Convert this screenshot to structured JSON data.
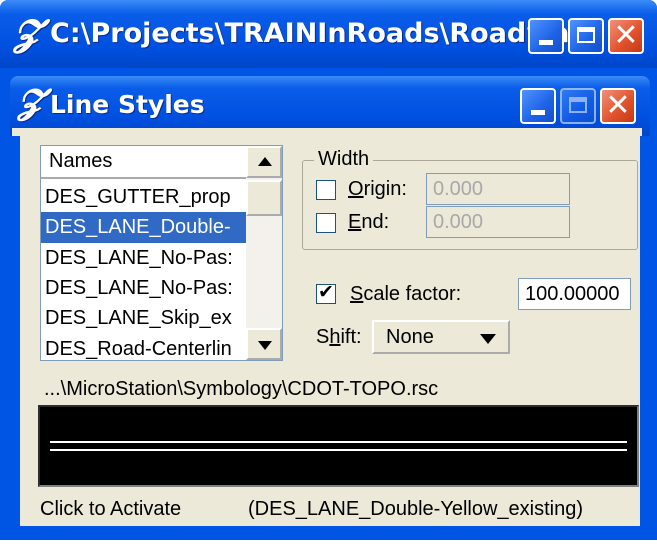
{
  "outer_window": {
    "title": "C:\\Projects\\TRAINInRoads\\Roadwa...",
    "icon": "microstation-icon"
  },
  "dialog": {
    "title": "Line Styles",
    "icon": "microstation-icon"
  },
  "list": {
    "header": "Names",
    "items": [
      "DES_GUTTER_prop",
      "DES_LANE_Double-",
      "DES_LANE_No-Pas:",
      "DES_LANE_No-Pas:",
      "DES_LANE_Skip_ex",
      "DES_Road-Centerlin"
    ],
    "selected_index": 1
  },
  "width_group": {
    "label": "Width",
    "origin_label_first": "O",
    "origin_label_rest": "rigin:",
    "origin_value": "0.000",
    "origin_checked": false,
    "end_label_first": "E",
    "end_label_rest": "nd:",
    "end_value": "0.000",
    "end_checked": false
  },
  "scale": {
    "label_first": "S",
    "label_rest": "cale factor:",
    "checked": true,
    "value": "100.00000"
  },
  "shift": {
    "label_pre": "S",
    "label_first": "h",
    "label_rest": "ift:",
    "selected": "None"
  },
  "resource_path": "...\\MicroStation\\Symbology\\CDOT-TOPO.rsc",
  "status": {
    "left": "Click to Activate",
    "right": "(DES_LANE_Double-Yellow_existing)"
  },
  "colors": {
    "title_bar": "#0055e5",
    "selection": "#316ac5",
    "dialog_face": "#ece9d8",
    "close_button": "#e0502a"
  }
}
